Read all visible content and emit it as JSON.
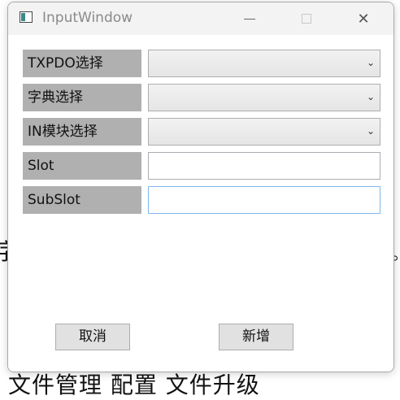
{
  "window": {
    "title": "InputWindow"
  },
  "titlebar": {
    "minimize_icon": "minimize-icon",
    "maximize_icon": "maximize-icon",
    "close_icon": "close-icon",
    "close_glyph": "✕"
  },
  "form": {
    "rows": [
      {
        "label": "TXPDO选择",
        "kind": "combo",
        "value": ""
      },
      {
        "label": "字典选择",
        "kind": "combo",
        "value": ""
      },
      {
        "label": "IN模块选择",
        "kind": "combo",
        "value": ""
      },
      {
        "label": "Slot",
        "kind": "text",
        "value": ""
      },
      {
        "label": "SubSlot",
        "kind": "text",
        "value": ""
      }
    ],
    "chevron_glyph": "⌄"
  },
  "buttons": {
    "cancel": "取消",
    "add": "新增"
  },
  "background": {
    "left_fragment": "字",
    "right_fragment": "。",
    "bottom_fragment": "文件管理     配置 文件升级"
  }
}
